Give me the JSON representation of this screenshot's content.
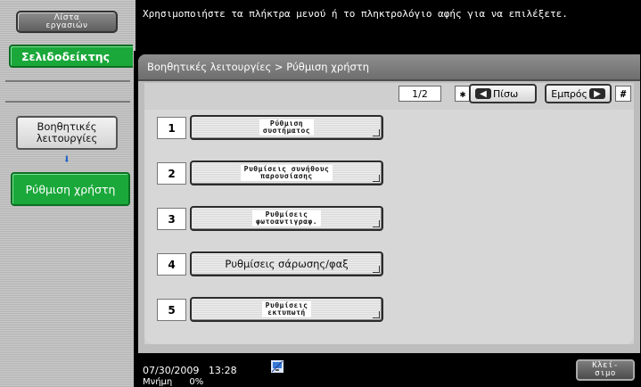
{
  "sidebar": {
    "job_list_label": "Λίστα\nεργασιών",
    "bookmark_label": "Σελιδοδείκτης",
    "crumbs": [
      {
        "label": "Βοηθητικές\nλειτουργίες"
      },
      {
        "label": "Ρύθμιση χρήστη"
      }
    ],
    "crumb_arrow": "⬇"
  },
  "message": "Χρησιμοποιήστε τα πλήκτρα μενού ή το πληκτρολόγιο αφής για να επιλέξετε.",
  "panel": {
    "breadcrumb": "Βοηθητικές λειτουργίες > Ρύθμιση χρήστη"
  },
  "pager": {
    "page": "1/2",
    "star_key": "✱",
    "hash_key": "#",
    "back_label": "Πίσω",
    "forward_label": "Εμπρός"
  },
  "menu": [
    {
      "number": "1",
      "label": "Ρύθμιση\nσυστήματος",
      "style": "small"
    },
    {
      "number": "2",
      "label": "Ρυθμίσεις συνήθους\nπαρουσίασης",
      "style": "small"
    },
    {
      "number": "3",
      "label": "Ρυθμίσεις\nφωτοαντιγραφ.",
      "style": "small"
    },
    {
      "number": "4",
      "label": "Ρυθμίσεις σάρωσης/φαξ",
      "style": "big"
    },
    {
      "number": "5",
      "label": "Ρυθμίσεις\nεκτυπωτή",
      "style": "small"
    }
  ],
  "footer": {
    "date": "07/30/2009",
    "time": "13:28",
    "memory_label": "Μνήμη",
    "memory_value": "0%",
    "close_label": "Κλεί-\nσιμο"
  },
  "colors": {
    "active_green": "#1aa83a",
    "nav_blue": "#1a5fc9"
  }
}
